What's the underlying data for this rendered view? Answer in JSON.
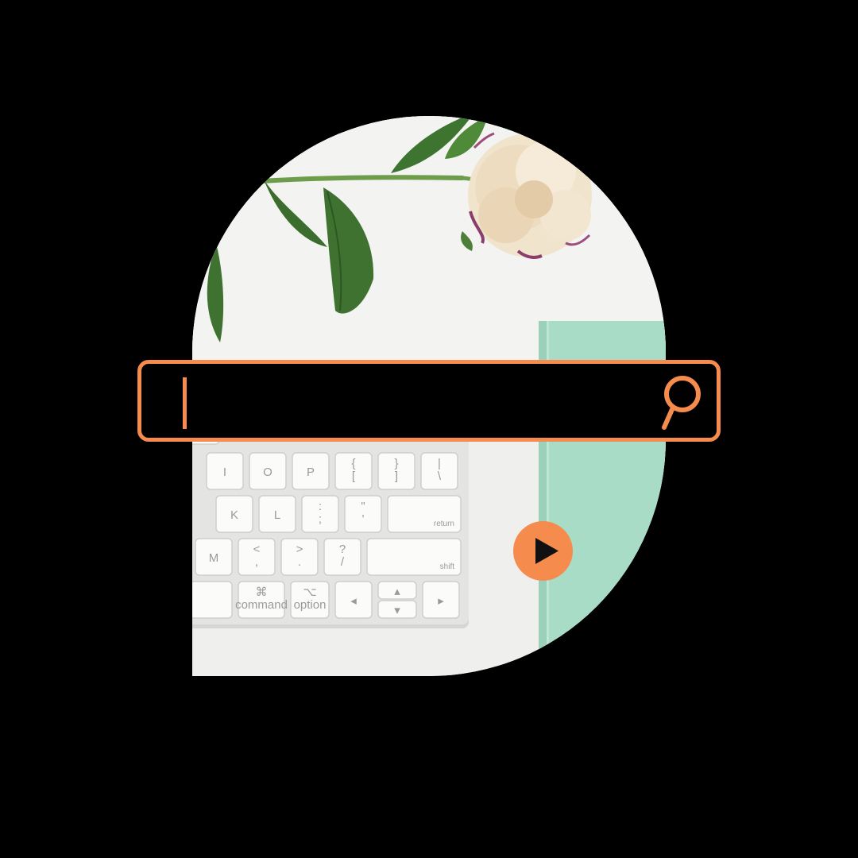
{
  "search": {
    "value": "",
    "placeholder": ""
  },
  "icons": {
    "search": "search-icon",
    "play": "play-icon",
    "cursor": "text-cursor"
  },
  "keyboard": {
    "row1": [
      "I",
      "O",
      "P",
      "{\n[",
      "}\n]",
      "|\n\\"
    ],
    "row2": [
      "K",
      "L",
      ":\n;",
      "\"\n'",
      "return"
    ],
    "row3": [
      "M",
      "<\n,",
      ">\n.",
      "?\n/",
      "shift"
    ],
    "row4_labels": [
      "command",
      "option"
    ],
    "row4_symbols": [
      "⌘",
      "⌥",
      "◂",
      "▴",
      "▾",
      "▸"
    ]
  },
  "colors": {
    "accent": "#f58b4c",
    "background": "#000000",
    "desk": "#efefee",
    "notebook": "#a8dcc6"
  }
}
